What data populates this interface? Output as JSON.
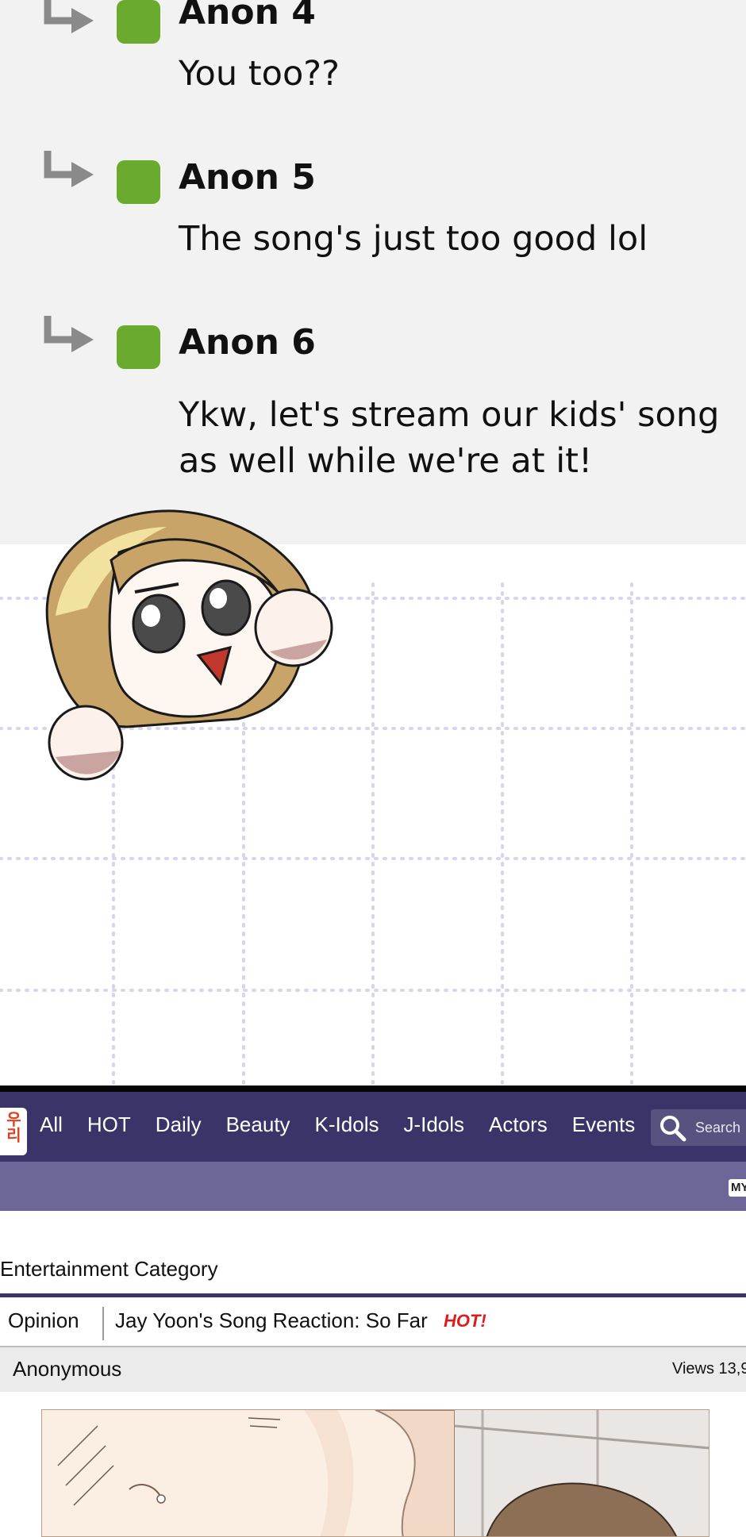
{
  "comments": [
    {
      "name": "Anon 4",
      "text": "You too??"
    },
    {
      "name": "Anon 5",
      "text": "The song's just too good lol"
    },
    {
      "name": "Anon 6",
      "text": "Ykw, let's stream our kids' song as well while we're at it!"
    }
  ],
  "forum": {
    "logo_text": "우리말",
    "nav": [
      "All",
      "HOT",
      "Daily",
      "Beauty",
      "K-Idols",
      "J-Idols",
      "Actors",
      "Events"
    ],
    "search_placeholder": "Search",
    "subbar_badge": "MY",
    "category": "Entertainment Category",
    "post": {
      "tag": "Opinion",
      "title": "Jay Yoon's Song Reaction: So Far",
      "hot_label": "HOT!",
      "author": "Anonymous",
      "views": "Views 13,9"
    }
  },
  "colors": {
    "thread_bg": "#f2f2f2",
    "avatar": "#6aaa2e",
    "nav_bg": "#3a3468",
    "subbar_bg": "#6d6799",
    "hot": "#e01b1b",
    "grid_dots": "#d6d4ee"
  }
}
